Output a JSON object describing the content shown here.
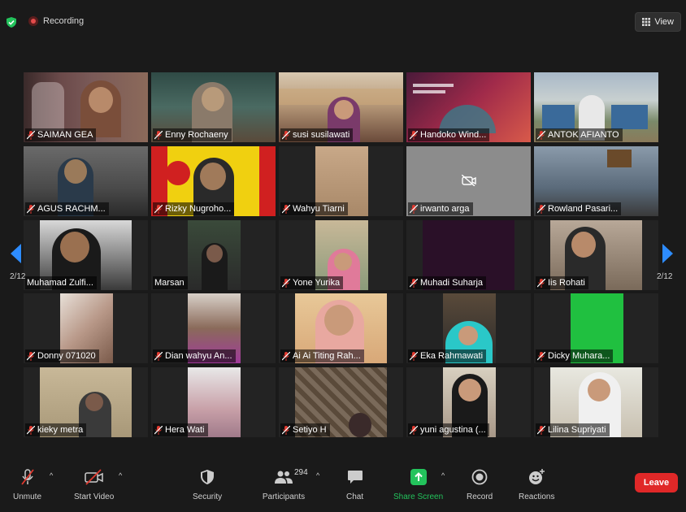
{
  "top_bar": {
    "recording_label": "Recording",
    "view_label": "View"
  },
  "pagination": {
    "left": "2/12",
    "right": "2/12"
  },
  "participants": [
    {
      "name": "SAIMAN GEA",
      "muted": true
    },
    {
      "name": "Enny Rochaeny",
      "muted": true
    },
    {
      "name": "susi susilawati",
      "muted": true
    },
    {
      "name": "Handoko Wind...",
      "muted": true
    },
    {
      "name": "ANTOK AFIANTO",
      "muted": true
    },
    {
      "name": "AGUS RACHM...",
      "muted": true
    },
    {
      "name": "Rizky Nugroho...",
      "muted": true
    },
    {
      "name": "Wahyu Tiarni",
      "muted": true
    },
    {
      "name": "irwanto arga",
      "muted": true
    },
    {
      "name": "Rowland Pasari...",
      "muted": true
    },
    {
      "name": "Muhamad Zulfi...",
      "muted": false
    },
    {
      "name": "Marsan",
      "muted": false
    },
    {
      "name": "Yone Yurika",
      "muted": true
    },
    {
      "name": "Muhadi Suharja",
      "muted": true
    },
    {
      "name": "Iis Rohati",
      "muted": true
    },
    {
      "name": "Donny 071020",
      "muted": true
    },
    {
      "name": "Dian wahyu An...",
      "muted": true
    },
    {
      "name": "Ai Ai Titing Rah...",
      "muted": true
    },
    {
      "name": "Eka Rahmawati",
      "muted": true
    },
    {
      "name": "Dicky Muhara...",
      "muted": true
    },
    {
      "name": "kieky metra",
      "muted": true
    },
    {
      "name": "Hera Wati",
      "muted": true
    },
    {
      "name": "Setiyo H",
      "muted": true
    },
    {
      "name": "yuni agustina (...",
      "muted": true
    },
    {
      "name": "Lilina Supriyati",
      "muted": true
    }
  ],
  "toolbar": {
    "unmute": "Unmute",
    "start_video": "Start Video",
    "security": "Security",
    "participants": "Participants",
    "participants_count": "294",
    "chat": "Chat",
    "share_screen": "Share Screen",
    "record": "Record",
    "reactions": "Reactions",
    "leave": "Leave"
  },
  "colors": {
    "accent_blue": "#2d8cff",
    "share_green": "#23c35c",
    "leave_red": "#e02828",
    "muted_red": "#e0392f"
  },
  "icons": {
    "shield": "shield-icon",
    "recording": "recording-dot-icon",
    "view": "grid-view-icon",
    "mic_off": "mic-off-icon",
    "video_off": "video-off-icon",
    "security": "security-shield-icon",
    "participants": "people-icon",
    "chat": "chat-bubble-icon",
    "share_screen": "share-arrow-icon",
    "record": "record-icon",
    "reactions": "emoji-add-icon",
    "camera_off": "camera-off-icon"
  }
}
